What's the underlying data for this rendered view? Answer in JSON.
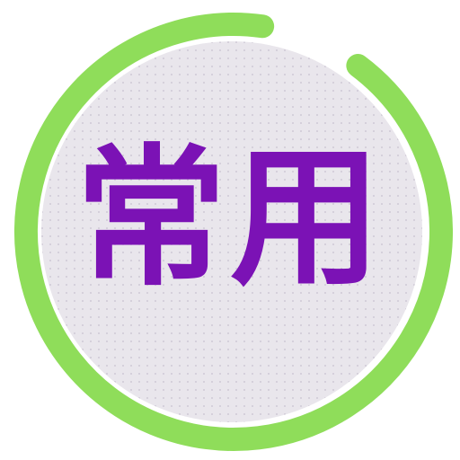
{
  "app_icon": {
    "label": "常用",
    "progress": 0.92
  },
  "colors": {
    "ring": "#8fdd5a",
    "disc": "#e9e6ec",
    "dots": "#cfc9d6",
    "label": "#7b12b5"
  }
}
